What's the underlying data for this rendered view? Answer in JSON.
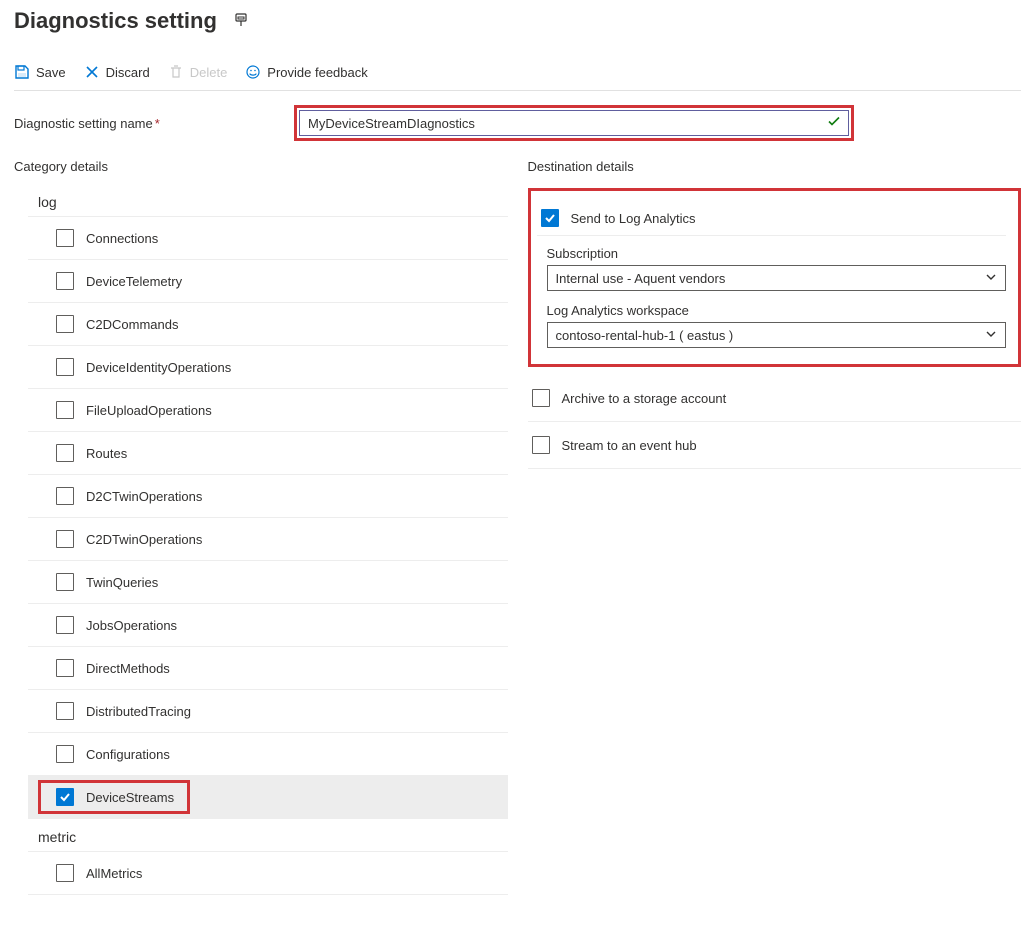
{
  "header": {
    "title": "Diagnostics setting"
  },
  "toolbar": {
    "save": "Save",
    "discard": "Discard",
    "delete": "Delete",
    "feedback": "Provide feedback"
  },
  "form": {
    "name_label": "Diagnostic setting name",
    "name_value": "MyDeviceStreamDIagnostics"
  },
  "categories": {
    "title": "Category details",
    "log_header": "log",
    "metric_header": "metric",
    "log_items": [
      {
        "label": "Connections",
        "checked": false,
        "highlighted": false
      },
      {
        "label": "DeviceTelemetry",
        "checked": false,
        "highlighted": false
      },
      {
        "label": "C2DCommands",
        "checked": false,
        "highlighted": false
      },
      {
        "label": "DeviceIdentityOperations",
        "checked": false,
        "highlighted": false
      },
      {
        "label": "FileUploadOperations",
        "checked": false,
        "highlighted": false
      },
      {
        "label": "Routes",
        "checked": false,
        "highlighted": false
      },
      {
        "label": "D2CTwinOperations",
        "checked": false,
        "highlighted": false
      },
      {
        "label": "C2DTwinOperations",
        "checked": false,
        "highlighted": false
      },
      {
        "label": "TwinQueries",
        "checked": false,
        "highlighted": false
      },
      {
        "label": "JobsOperations",
        "checked": false,
        "highlighted": false
      },
      {
        "label": "DirectMethods",
        "checked": false,
        "highlighted": false
      },
      {
        "label": "DistributedTracing",
        "checked": false,
        "highlighted": false
      },
      {
        "label": "Configurations",
        "checked": false,
        "highlighted": false
      },
      {
        "label": "DeviceStreams",
        "checked": true,
        "highlighted": true
      }
    ],
    "metric_items": [
      {
        "label": "AllMetrics",
        "checked": false
      }
    ]
  },
  "destinations": {
    "title": "Destination details",
    "log_analytics": {
      "label": "Send to Log Analytics",
      "checked": true,
      "subscription_label": "Subscription",
      "subscription_value": "Internal use - Aquent vendors",
      "workspace_label": "Log Analytics workspace",
      "workspace_value": "contoso-rental-hub-1 ( eastus )"
    },
    "storage": {
      "label": "Archive to a storage account",
      "checked": false
    },
    "eventhub": {
      "label": "Stream to an event hub",
      "checked": false
    }
  }
}
